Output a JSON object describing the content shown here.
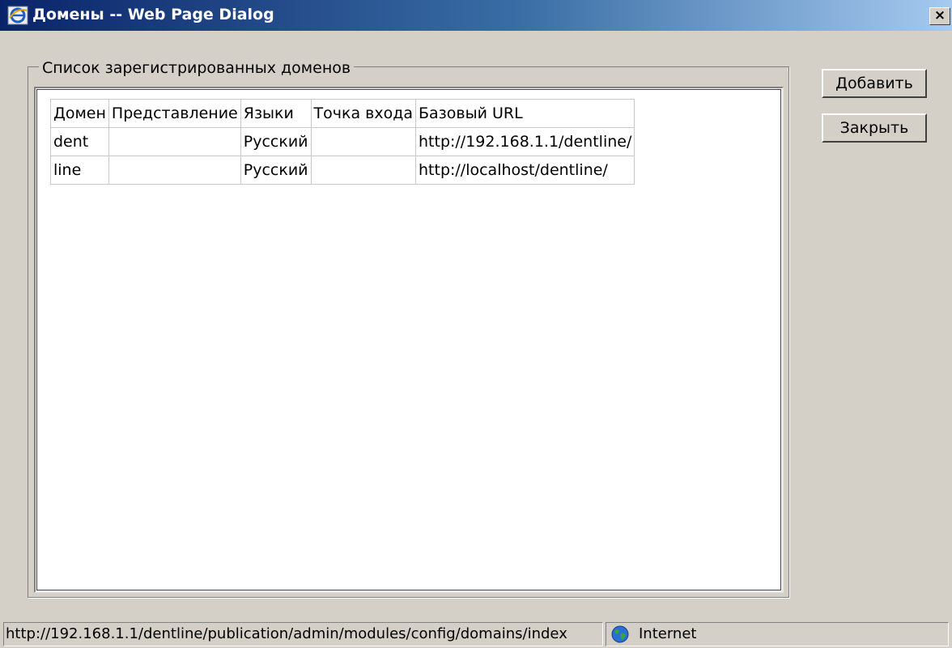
{
  "window": {
    "title": "Домены -- Web Page Dialog",
    "close_label": "×",
    "icon": "ie-app-icon"
  },
  "group": {
    "legend": "Список зарегистрированных доменов"
  },
  "table": {
    "columns": [
      "Домен",
      "Представление",
      "Языки",
      "Точка входа",
      "Базовый URL"
    ],
    "rows": [
      [
        "dent",
        "",
        "Русский",
        "",
        "http://192.168.1.1/dentline/"
      ],
      [
        "line",
        "",
        "Русский",
        "",
        "http://localhost/dentline/"
      ]
    ]
  },
  "buttons": {
    "add": "Добавить",
    "close": "Закрыть"
  },
  "status": {
    "url": "http://192.168.1.1/dentline/publication/admin/modules/config/domains/index",
    "zone": "Internet",
    "zone_icon": "globe-icon"
  },
  "colors": {
    "title_gradient_start": "#0a246a",
    "title_gradient_end": "#a6caf0",
    "dialog_bg": "#d4d0c8"
  }
}
